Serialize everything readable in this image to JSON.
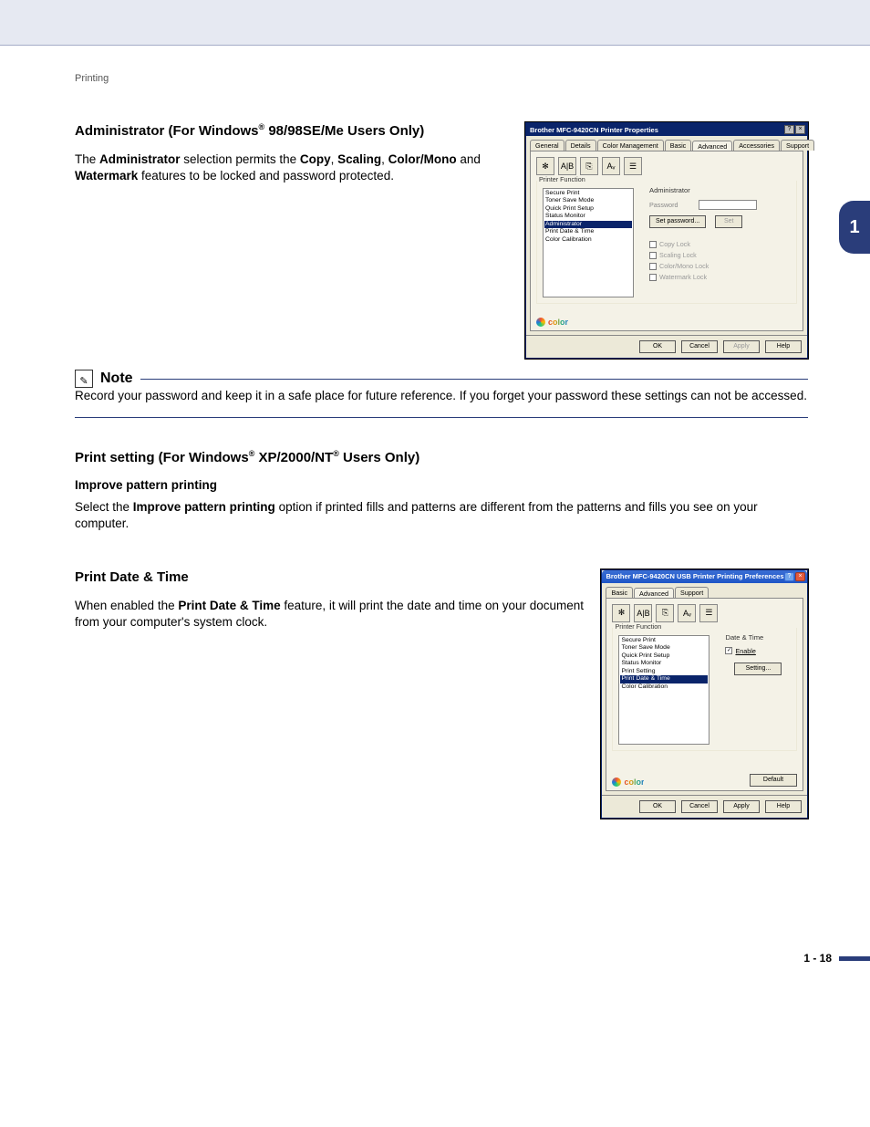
{
  "breadcrumb": "Printing",
  "chapter_tab": "1",
  "footer": "1 - 18",
  "section1": {
    "heading_before_sup": "Administrator (For Windows",
    "heading_after_sup": " 98/98SE/Me Users Only)",
    "sup": "®",
    "para_parts": [
      "The ",
      "Administrator",
      " selection permits the ",
      "Copy",
      ", ",
      "Scaling",
      ", ",
      "Color/Mono",
      " and ",
      "Watermark",
      " features to be locked and password protected."
    ]
  },
  "note": {
    "label": "Note",
    "icon_glyph": "✎",
    "text": "Record your password and keep it in a safe place for future reference. If you forget your password these settings can not be accessed."
  },
  "section2": {
    "h_parts": [
      "Print setting (For Windows",
      "®",
      " XP/2000/NT",
      "®",
      " Users Only)"
    ],
    "sub": "Improve pattern printing",
    "para_parts": [
      "Select the ",
      "Improve pattern printing",
      " option if printed fills and patterns are different from the patterns and fills you see on your computer."
    ]
  },
  "section3": {
    "heading": "Print Date & Time",
    "para_parts": [
      "When enabled the ",
      "Print Date & Time",
      " feature, it will print the date and time on your document from your computer's system clock."
    ]
  },
  "dlg1": {
    "title": "Brother MFC-9420CN Printer Properties",
    "tabs": [
      "General",
      "Details",
      "Color Management",
      "Basic",
      "Advanced",
      "Accessories",
      "Support"
    ],
    "active_tab": 4,
    "icon_labels": [
      "✻",
      "A|B",
      "⎘",
      "Aᵥ",
      "☰"
    ],
    "printer_function_label": "Printer Function",
    "printer_functions": [
      "Secure Print",
      "Toner Save Mode",
      "Quick Print Setup",
      "Status Monitor",
      "Administrator",
      "Print Date & Time",
      "Color Calibration"
    ],
    "printer_functions_selected": 4,
    "panel_title": "Administrator",
    "password_label": "Password",
    "set_password_btn": "Set password...",
    "set_btn": "Set",
    "lock_checks": [
      "Copy Lock",
      "Scaling Lock",
      "Color/Mono Lock",
      "Watermark Lock"
    ],
    "color_label": "color",
    "footer_buttons": [
      "OK",
      "Cancel",
      "Apply",
      "Help"
    ],
    "disabled_buttons": [
      2
    ]
  },
  "dlg2": {
    "title": "Brother MFC-9420CN USB Printer Printing Preferences",
    "tabs": [
      "Basic",
      "Advanced",
      "Support"
    ],
    "active_tab": 1,
    "icon_labels": [
      "✻",
      "A|B",
      "⎘",
      "Aᵥ",
      "☰"
    ],
    "printer_function_label": "Printer Function",
    "printer_functions": [
      "Secure Print",
      "Toner Save Mode",
      "Quick Print Setup",
      "Status Monitor",
      "Print Setting",
      "Print Date & Time",
      "Color Calibration"
    ],
    "printer_functions_selected": 5,
    "panel_title": "Date & Time",
    "enable_label": "Enable",
    "enable_checked": true,
    "setting_btn": "Setting...",
    "default_btn": "Default",
    "color_label": "color",
    "footer_buttons": [
      "OK",
      "Cancel",
      "Apply",
      "Help"
    ]
  }
}
